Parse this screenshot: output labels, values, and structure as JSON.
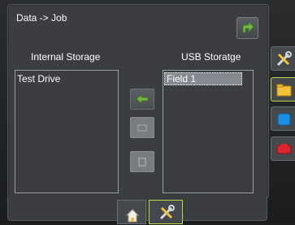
{
  "dialog": {
    "title": "Data -> Job"
  },
  "internal_storage": {
    "label": "Internal Storage",
    "items": [
      "Test Drive"
    ]
  },
  "usb_storage": {
    "label": "USB Storatge",
    "items": [
      "Field 1"
    ],
    "selected": "Field 1"
  },
  "side_tabs": [
    {
      "icon": "wrench-screwdriver-icon",
      "active": false
    },
    {
      "icon": "folder-icon",
      "active": true
    },
    {
      "icon": "blue-square-icon",
      "active": false
    },
    {
      "icon": "red-tractor-icon",
      "active": false
    }
  ],
  "bottom_tabs": [
    {
      "icon": "home-icon",
      "active": false
    },
    {
      "icon": "tools-icon",
      "active": true
    }
  ],
  "colors": {
    "accent_green": "#6fb83c",
    "active_border": "#b8d84a",
    "folder_yellow": "#f0c23a",
    "blue_tab": "#1b8fe6",
    "red_tab": "#d9262c"
  }
}
